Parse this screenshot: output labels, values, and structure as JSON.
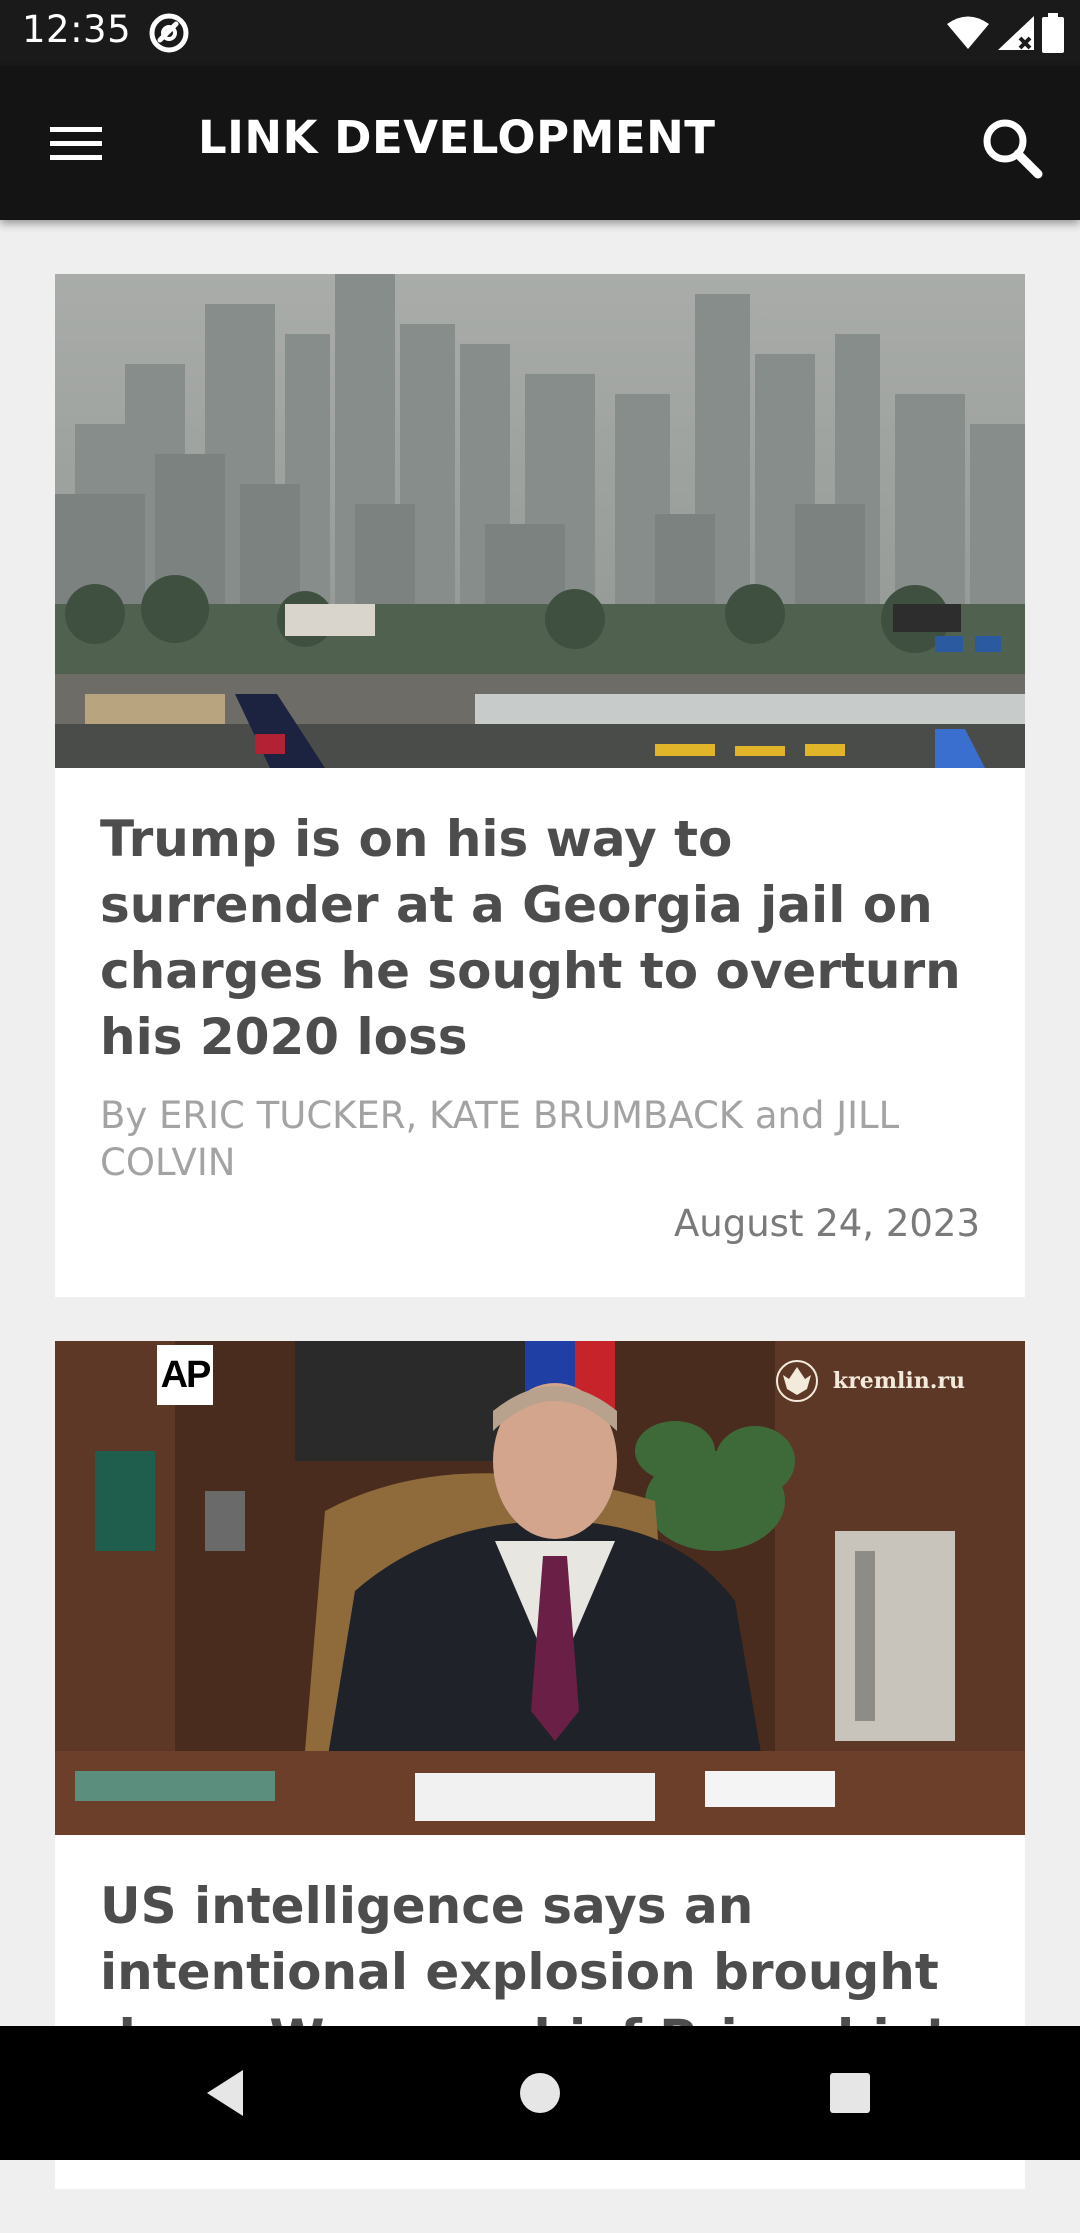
{
  "status_bar": {
    "time": "12:35",
    "icons": [
      "at-sign-icon",
      "wifi-icon",
      "signal-icon",
      "battery-icon"
    ]
  },
  "app_bar": {
    "title": "LINK DEVELOPMENT",
    "menu_icon": "hamburger-menu-icon",
    "search_icon": "search-icon"
  },
  "articles": [
    {
      "title": "Trump is on his way to surrender at a Georgia jail on charges he sought to overturn his 2020 loss",
      "byline": "By ERIC TUCKER, KATE BRUMBACK and JILL COLVIN",
      "date": "August 24, 2023"
    },
    {
      "title": "US intelligence says an intentional explosion brought down Wagner chief Prigozhin’s pl",
      "image_badge": "AP",
      "image_watermark": "kremlin.ru"
    }
  ],
  "nav_bar": {
    "icons": [
      "back-triangle-icon",
      "home-circle-icon",
      "recents-square-icon"
    ]
  },
  "colors": {
    "app_bar": "#141414",
    "background": "#efefef",
    "card": "#ffffff",
    "title_text": "#4d4d4d",
    "byline_text": "#a3a3a3"
  }
}
